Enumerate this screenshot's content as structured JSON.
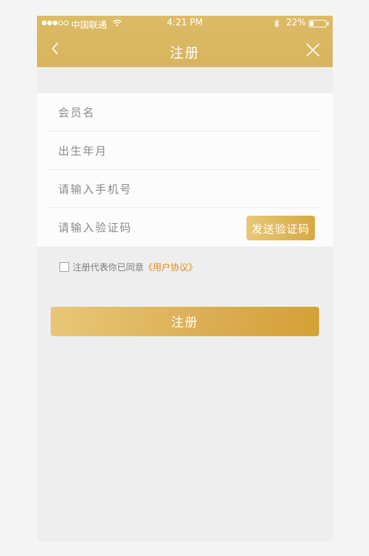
{
  "status_bar": {
    "carrier": "中国联通",
    "time": "4:21 PM",
    "battery_percent": "22%",
    "battery_level": 0.22,
    "signal_bars": 3,
    "signal_total": 5
  },
  "navbar": {
    "title": "注册",
    "back_icon": "chevron-left-icon",
    "close_icon": "close-icon"
  },
  "form": {
    "member_name": {
      "placeholder": "会员名",
      "value": ""
    },
    "birth_month": {
      "placeholder": "出生年月",
      "value": ""
    },
    "phone": {
      "placeholder": "请输入手机号",
      "value": ""
    },
    "code": {
      "placeholder": "请输入验证码",
      "value": ""
    },
    "send_code_label": "发送验证码"
  },
  "agreement": {
    "checked": false,
    "text": "注册代表你已同意",
    "link_text": "《用户协议》"
  },
  "submit_label": "注册",
  "colors": {
    "header": "#d8b45d",
    "accent_link": "#e5880f",
    "button_start": "#e8c778",
    "button_end": "#d4a136"
  }
}
